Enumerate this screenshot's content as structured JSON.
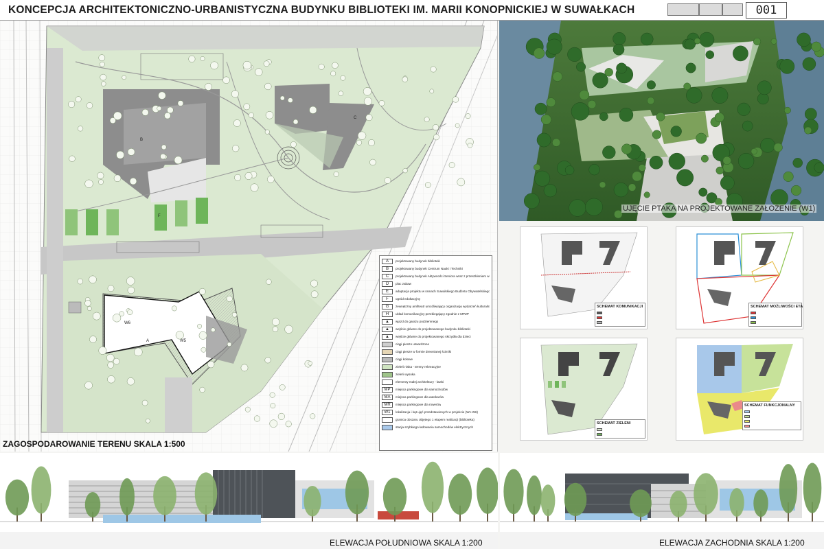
{
  "header": {
    "title": "KONCEPCJA ARCHITEKTONICZNO-URBANISTYCZNA BUDYNKU BIBLIOTEKI IM. MARII KONOPNICKIEJ W SUWAŁKACH",
    "sheet_number": "001"
  },
  "plan": {
    "label": "ZAGOSPODAROWANIE TERENU SKALA 1:500",
    "building_labels": [
      "A",
      "B",
      "C",
      "W6",
      "W5",
      "F"
    ]
  },
  "legend": {
    "items": [
      {
        "symbol": "A",
        "text": "projektowany budynek biblioteki"
      },
      {
        "symbol": "B",
        "text": "projektowany budynek Centrum Nauki i Techniki"
      },
      {
        "symbol": "C",
        "text": "projektowany budynek Aktywności Seniora wraz z przeszkleniem wielofunkcyjnym i wystawienniczym otoczony parkiem"
      },
      {
        "symbol": "D",
        "text": "plac zabaw"
      },
      {
        "symbol": "E",
        "text": "adaptacja projektu w ramach Suwalskiego Budżetu Obywatelskiego \"Gaj w centrum\""
      },
      {
        "symbol": "F",
        "text": "ogród edukacyjny"
      },
      {
        "symbol": "G",
        "text": "zewnętrzny amfiteatr umożliwiający organizację wydarzeń kulturalnych i pokazów filmowych"
      },
      {
        "symbol": "H",
        "text": "układ komunikacyjny przebiegający zgodnie z MPZP"
      },
      {
        "symbol": "▲",
        "text": "wjazd do garażu podziemnego"
      },
      {
        "symbol": "▲",
        "text": "wejście główne do projektowanego budynku biblioteki"
      },
      {
        "symbol": "▲",
        "text": "wejście główne do projektowanego skrzydła dla dzieci"
      },
      {
        "symbol": "",
        "text": "ciągi pieszo utwardzone"
      },
      {
        "symbol": "",
        "text": "ciągi piesze w formie drewnianej ścieżki"
      },
      {
        "symbol": "",
        "text": "ciągi kołowe"
      },
      {
        "symbol": "",
        "text": "zieleń niska - tereny rekreacyjne"
      },
      {
        "symbol": "",
        "text": "zieleń wysoka"
      },
      {
        "symbol": "",
        "text": "elementy małej architektury - ławki"
      },
      {
        "symbol": "MP",
        "text": "miejsca parkingowe dla samochodów"
      },
      {
        "symbol": "MA",
        "text": "miejsca parkingowe dla autokarów"
      },
      {
        "symbol": "MR",
        "text": "miejsca parkingowe dla rowerów"
      },
      {
        "symbol": "W1",
        "text": "lokalizacja i kąt ujęć przedstawionych w projekcie (W1-W6)"
      },
      {
        "symbol": "",
        "text": "granica obszaru objętego 1 etapem realizacji (biblioteka)"
      },
      {
        "symbol": "",
        "text": "stacja szybkiego ładowania samochodów elektrycznych"
      }
    ]
  },
  "render": {
    "caption": "UJĘCIE PTAKA NA PROJEKTOWANE ZAŁOŻENIE (W1)"
  },
  "schemas": [
    {
      "title": "SCHEMAT KOMUNIKACJI"
    },
    {
      "title": "SCHEMAT MOŻLIWOŚCI ETAPOWANIA INWESTYCJI"
    },
    {
      "title": "SCHEMAT ZIELENI"
    },
    {
      "title": "SCHEMAT FUNKCJONALNY"
    }
  ],
  "elevations": {
    "south": "ELEWACJA POŁUDNIOWA SKALA 1:200",
    "west": "ELEWACJA ZACHODNIA SKALA 1:200"
  },
  "colors": {
    "park_green": "#dcebd3",
    "lawn_green": "#7bbf68",
    "building_grey": "#8a8a8a",
    "road_grey": "#c9c9c9",
    "glass_blue": "#9ec7e6",
    "phase_yellow": "#e9e86a",
    "phase_blue": "#a8c8ea"
  }
}
